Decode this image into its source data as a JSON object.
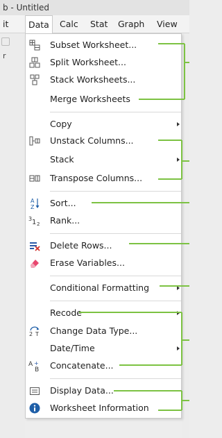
{
  "window": {
    "title": "b - Untitled"
  },
  "menubar": {
    "items": [
      "it",
      "Data",
      "Calc",
      "Stat",
      "Graph",
      "View"
    ]
  },
  "leftstrip": {
    "label": "r"
  },
  "menu": {
    "items": [
      {
        "label": "Subset Worksheet...",
        "icon": "subset-worksheet-icon"
      },
      {
        "label": "Split Worksheet...",
        "icon": "split-worksheet-icon"
      },
      {
        "label": "Stack Worksheets...",
        "icon": "stack-worksheets-icon"
      },
      {
        "label": "Merge Worksheets",
        "icon": ""
      },
      {
        "label": "Copy",
        "icon": "",
        "submenu": true
      },
      {
        "label": "Unstack Columns...",
        "icon": "unstack-columns-icon"
      },
      {
        "label": "Stack",
        "icon": "",
        "submenu": true
      },
      {
        "label": "Transpose Columns...",
        "icon": "transpose-columns-icon"
      },
      {
        "label": "Sort...",
        "icon": "sort-icon"
      },
      {
        "label": "Rank...",
        "icon": "rank-icon"
      },
      {
        "label": "Delete Rows...",
        "icon": "delete-rows-icon"
      },
      {
        "label": "Erase Variables...",
        "icon": "eraser-icon"
      },
      {
        "label": "Conditional Formatting",
        "icon": "",
        "submenu": true
      },
      {
        "label": "Recode",
        "icon": "",
        "submenu": true
      },
      {
        "label": "Change Data Type...",
        "icon": "change-data-type-icon"
      },
      {
        "label": "Date/Time",
        "icon": "",
        "submenu": true
      },
      {
        "label": "Concatenate...",
        "icon": "concatenate-icon"
      },
      {
        "label": "Display Data...",
        "icon": "display-data-icon"
      },
      {
        "label": "Worksheet Information",
        "icon": "info-icon"
      }
    ]
  },
  "annotation_color": "#7cc242"
}
